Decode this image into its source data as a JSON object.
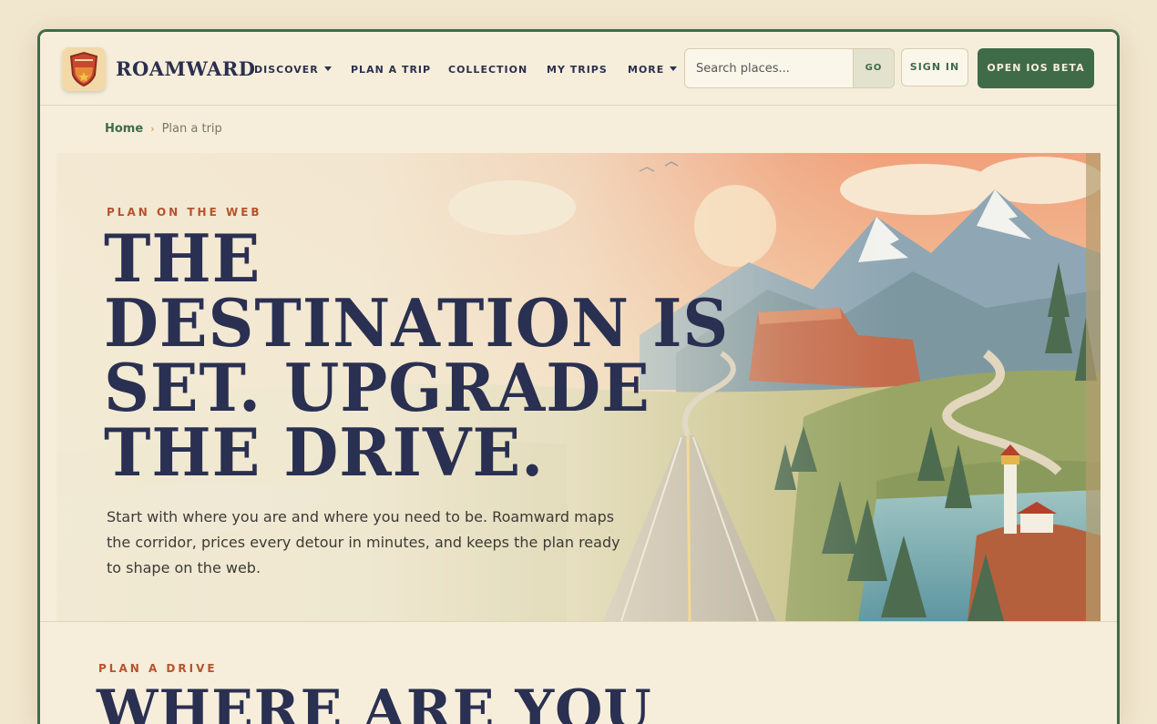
{
  "header": {
    "brand": "ROAMWARD",
    "nav": [
      {
        "label": "DISCOVER",
        "has_caret": true
      },
      {
        "label": "PLAN A TRIP",
        "has_caret": false
      },
      {
        "label": "COLLECTION",
        "has_caret": false
      },
      {
        "label": "MY TRIPS",
        "has_caret": false
      },
      {
        "label": "MORE",
        "has_caret": true
      }
    ],
    "search": {
      "placeholder": "Search places...",
      "value": "",
      "go_label": "GO"
    },
    "sign_in_label": "SIGN IN",
    "beta_label": "OPEN IOS BETA"
  },
  "breadcrumb": {
    "home": "Home",
    "separator": "›",
    "current": "Plan a trip"
  },
  "hero": {
    "eyebrow": "PLAN ON THE WEB",
    "headline": "THE DESTINATION IS SET. UPGRADE THE DRIVE.",
    "lede": "Start with where you are and where you need to be. Roamward maps the corridor, prices every detour in minutes, and keeps the plan ready to shape on the web."
  },
  "section": {
    "eyebrow": "PLAN A DRIVE",
    "title": "WHERE ARE YOU"
  },
  "colors": {
    "accent_green": "#3f6b49",
    "ink_navy": "#2a3051",
    "eyebrow_rust": "#b5532c",
    "page_cream": "#f6eedb"
  }
}
